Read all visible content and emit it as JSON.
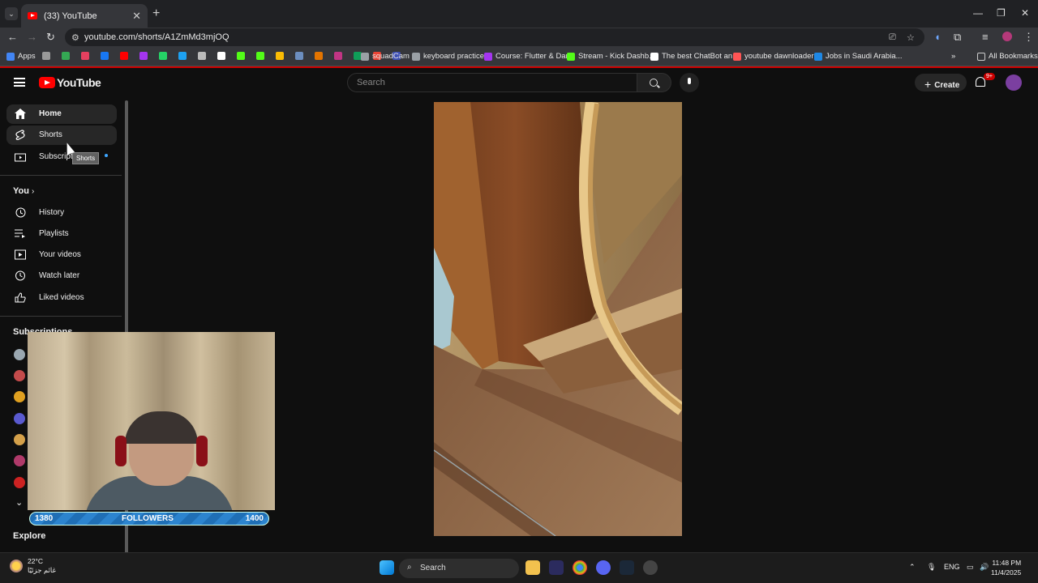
{
  "browser": {
    "tab_title": "(33) YouTube",
    "url": "youtube.com/shorts/A1ZmMd3mjOQ",
    "bookmarks": [
      {
        "label": "Apps",
        "color": "#4285f4"
      },
      {
        "label": "squadCam",
        "color": "#9aa0a6"
      },
      {
        "label": "keyboard practice",
        "color": "#9aa0a6"
      },
      {
        "label": "Course: Flutter & Dart",
        "color": "#a435f0"
      },
      {
        "label": "Stream - Kick Dashb...",
        "color": "#53fc18"
      },
      {
        "label": "The best ChatBot an...",
        "color": "#ffffff"
      },
      {
        "label": "youtube dawnloader",
        "color": "#ff5555"
      },
      {
        "label": "Jobs in Saudi Arabia...",
        "color": "#1e88e5"
      }
    ],
    "all_bookmarks": "All Bookmarks"
  },
  "youtube": {
    "logo_text": "YouTube",
    "search_placeholder": "Search",
    "create_label": "Create",
    "notif_count": "9+",
    "sidebar": {
      "main": [
        {
          "label": "Home",
          "icon": "home-icon"
        },
        {
          "label": "Shorts",
          "icon": "shorts-icon"
        },
        {
          "label": "Subscriptions",
          "icon": "subscriptions-icon"
        }
      ],
      "you_heading": "You",
      "you_items": [
        {
          "label": "History",
          "icon": "history-icon"
        },
        {
          "label": "Playlists",
          "icon": "playlists-icon"
        },
        {
          "label": "Your videos",
          "icon": "your-videos-icon"
        },
        {
          "label": "Watch later",
          "icon": "watch-later-icon"
        },
        {
          "label": "Liked videos",
          "icon": "liked-videos-icon"
        }
      ],
      "subscriptions_heading": "Subscriptions",
      "subscription_colors": [
        "#9aa7b0",
        "#c44b4b",
        "#e0a020",
        "#5a5acf",
        "#d4a04a",
        "#b03a6a",
        "#cc2222"
      ],
      "explore_heading": "Explore",
      "tooltip": "Shorts"
    }
  },
  "overlay": {
    "followers_label": "FOLLOWERS",
    "followers_current": "1380",
    "followers_goal": "1400"
  },
  "taskbar": {
    "search_label": "Search",
    "weather_temp": "22°C",
    "weather_desc": "غائم جزئيًا",
    "language": "ENG",
    "time": "11:48 PM",
    "date": "11/4/2025"
  }
}
